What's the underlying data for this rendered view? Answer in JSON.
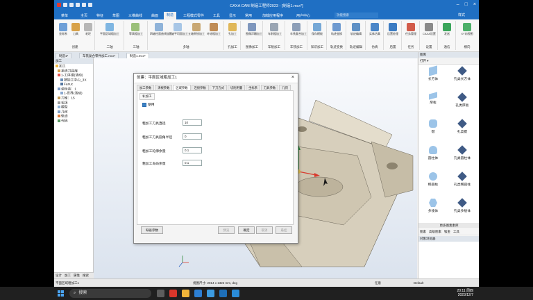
{
  "titlebar": {
    "title": "CAXA CAM 制造工程师2023 - [制造1.mcx*]"
  },
  "menu": {
    "items": [
      "菜单",
      "主页",
      "特征",
      "草图",
      "三维曲线",
      "曲面",
      "制造",
      "工程模式零件",
      "工具",
      "显示",
      "常用",
      "加载应用程序",
      "用户中心"
    ],
    "active_index": 6,
    "search_placeholder": "功能搜索",
    "style_label": "样式"
  },
  "ribbon": {
    "groups": [
      {
        "label": "创建",
        "buttons": [
          "坐标系",
          "刀具",
          "毛坯",
          "轮廓",
          "起始点"
        ]
      },
      {
        "label": "二轴",
        "buttons": [
          "平面区域粗加工"
        ]
      },
      {
        "label": "三轴",
        "buttons": [
          "等高粗加工"
        ]
      },
      {
        "label": "多轴",
        "buttons": [
          "四轴柱面曲线加工",
          "四轴平切面加工",
          "五轴侧铣加工",
          "叶轮粗加工"
        ]
      },
      {
        "label": "孔加工",
        "buttons": [
          "孔加工"
        ]
      },
      {
        "label": "图像加工",
        "buttons": [
          "图像浮雕加工"
        ]
      },
      {
        "label": "车削加工",
        "buttons": [
          "车削粗加工"
        ]
      },
      {
        "label": "车铣加工",
        "buttons": [
          "车铣复合加工"
        ]
      },
      {
        "label": "知识加工",
        "buttons": [
          "保存模板"
        ]
      },
      {
        "label": "轨迹变换",
        "buttons": [
          "轨迹变换"
        ]
      },
      {
        "label": "轨迹编辑",
        "buttons": [
          "轨迹编辑"
        ]
      },
      {
        "label": "仿真",
        "buttons": [
          "实体仿真"
        ]
      },
      {
        "label": "后置",
        "buttons": [
          "后置处理"
        ]
      },
      {
        "label": "任务",
        "buttons": [
          "任务管理"
        ]
      },
      {
        "label": "设置",
        "buttons": [
          "CAXA设置"
        ]
      },
      {
        "label": "通信",
        "buttons": [
          "发送"
        ]
      },
      {
        "label": "横向",
        "buttons": [
          "XY向视图"
        ]
      }
    ]
  },
  "doc_tabs": [
    "制造1*",
    "车铣复合零件加工.mcx*",
    "制造1.mcx*"
  ],
  "doc_tab_active": 2,
  "left_panel": {
    "title": "加工",
    "tree": [
      {
        "label": "加工",
        "level": 0
      },
      {
        "label": "系统刀具库",
        "level": 1
      },
      {
        "label": "1-工序组(活动)",
        "level": 1
      },
      {
        "label": "铣加工中心_3X",
        "level": 2
      },
      {
        "label": "Fanuc",
        "level": 2
      },
      {
        "label": "坐标系：1",
        "level": 1
      },
      {
        "label": "1-世界(活动)",
        "level": 2
      },
      {
        "label": "刀库：15",
        "level": 1
      },
      {
        "label": "毛坯",
        "level": 1
      },
      {
        "label": "模型",
        "level": 1
      },
      {
        "label": "几何",
        "level": 1
      },
      {
        "label": "轨迹",
        "level": 1
      },
      {
        "label": "代码",
        "level": 1
      }
    ],
    "tabs": [
      "设计",
      "加工",
      "属性",
      "搜索"
    ]
  },
  "dialog": {
    "title": "创建：平面区域粗加工1",
    "close": "×",
    "tabs": [
      "加工参数",
      "清根参数",
      "区域参数",
      "连接参数",
      "下刀方式",
      "切削用量",
      "坐标系",
      "刀具参数",
      "几何"
    ],
    "active_tab": 2,
    "subtab": "补加工",
    "checkbox_label": "使用",
    "fields": [
      {
        "label": "粗加工刀具直径",
        "value": "10"
      },
      {
        "label": "粗加工刀具圆角半径",
        "value": "0"
      },
      {
        "label": "粗加工轮廓余量",
        "value": "0.1"
      },
      {
        "label": "粗加工岛屿余量",
        "value": "0.1"
      }
    ],
    "buttons": {
      "default": "缺省参数",
      "preview": "预览",
      "ok": "确定",
      "cancel": "取消",
      "suspend": "悬挂"
    }
  },
  "right_panel": {
    "title": "图库",
    "toolbar": "打开 ▾",
    "shapes": [
      {
        "label": "长方体",
        "icon": "box-icon"
      },
      {
        "label": "孔类长方体",
        "icon": "hole-box-icon"
      },
      {
        "label": "厚板",
        "icon": "slab-icon"
      },
      {
        "label": "孔类厚板",
        "icon": "hole-slab-icon"
      },
      {
        "label": "键",
        "icon": "key-icon"
      },
      {
        "label": "孔类键",
        "icon": "hole-key-icon"
      },
      {
        "label": "圆柱体",
        "icon": "cylinder-icon"
      },
      {
        "label": "孔类圆柱体",
        "icon": "hole-cylinder-icon"
      },
      {
        "label": "椭圆柱",
        "icon": "ellipse-cylinder-icon"
      },
      {
        "label": "孔类椭圆柱",
        "icon": "hole-ellipse-cylinder-icon"
      },
      {
        "label": "多棱体",
        "icon": "prism-icon"
      },
      {
        "label": "孔类多棱体",
        "icon": "hole-prism-icon"
      }
    ],
    "subheader": "更多图素素库",
    "tabs": [
      "图素",
      "高级图素",
      "钣金",
      "工具"
    ],
    "bottom_title": "对象浏览器"
  },
  "status": {
    "left": "平面区域粗加工1",
    "middle": "视图尺寸: 2014 x 1322  mm, deg",
    "mode": "任意",
    "style": "Default"
  },
  "taskbar": {
    "search": "搜索",
    "time": "20:11 周四",
    "date": "2023/12/7"
  },
  "colors": {
    "accent": "#1f6fc3",
    "part": "#d7cfbc"
  }
}
